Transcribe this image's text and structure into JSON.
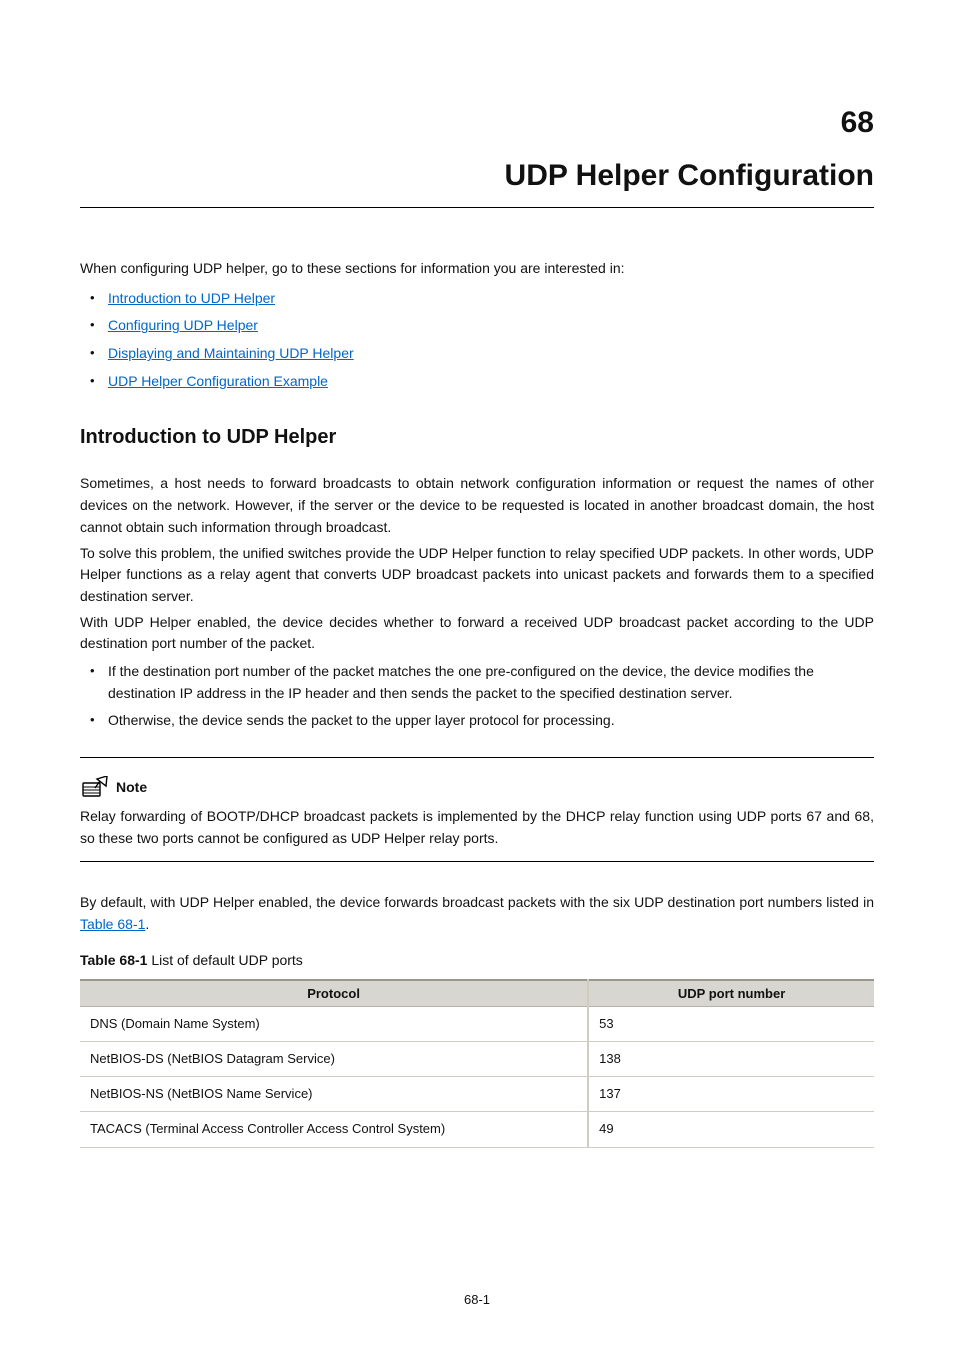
{
  "chapter": {
    "number": "68",
    "title": "UDP Helper Configuration"
  },
  "intro": "When configuring UDP helper, go to these sections for information you are interested in:",
  "toc": [
    "Introduction to UDP Helper",
    "Configuring UDP Helper",
    "Displaying and Maintaining UDP Helper",
    "UDP Helper Configuration Example"
  ],
  "sectionHeading": "Introduction to UDP Helper",
  "paragraphs": {
    "p1": "Sometimes, a host needs to forward broadcasts to obtain network configuration information or request the names of other devices on the network. However, if the server or the device to be requested is located in another broadcast domain, the host cannot obtain such information through broadcast.",
    "p2": "To solve this problem, the unified switches provide the UDP Helper function to relay specified UDP packets. In other words, UDP Helper functions as a relay agent that converts UDP broadcast packets into unicast packets and forwards them to a specified destination server.",
    "p3": "With UDP Helper enabled, the device decides whether to forward a received UDP broadcast packet according to the UDP destination port number of the packet.",
    "b1": "If the destination port number of the packet matches the one pre-configured on the device, the device modifies the destination IP address in the IP header and then sends the packet to the specified destination server.",
    "b2": "Otherwise, the device sends the packet to the upper layer protocol for processing."
  },
  "note": {
    "label": "Note",
    "body": "Relay forwarding of BOOTP/DHCP broadcast packets is implemented by the DHCP relay function using UDP ports 67 and 68, so these two ports cannot be configured as UDP Helper relay ports."
  },
  "postNote": {
    "prefix": "By default, with UDP Helper enabled, the device forwards broadcast packets with the six UDP destination port numbers listed in ",
    "link": "Table 68-1",
    "suffix": "."
  },
  "table": {
    "captionPrefix": "Table 68-1",
    "captionText": " List of default UDP ports",
    "header": {
      "col1": "Protocol",
      "col2": "UDP port number"
    },
    "rows": [
      {
        "proto": "DNS (Domain Name System)",
        "port": "53"
      },
      {
        "proto": "NetBIOS-DS (NetBIOS Datagram Service)",
        "port": "138"
      },
      {
        "proto": "NetBIOS-NS (NetBIOS Name Service)",
        "port": "137"
      },
      {
        "proto": "TACACS (Terminal Access Controller Access Control System)",
        "port": "49"
      }
    ]
  },
  "pageNumber": "68-1"
}
